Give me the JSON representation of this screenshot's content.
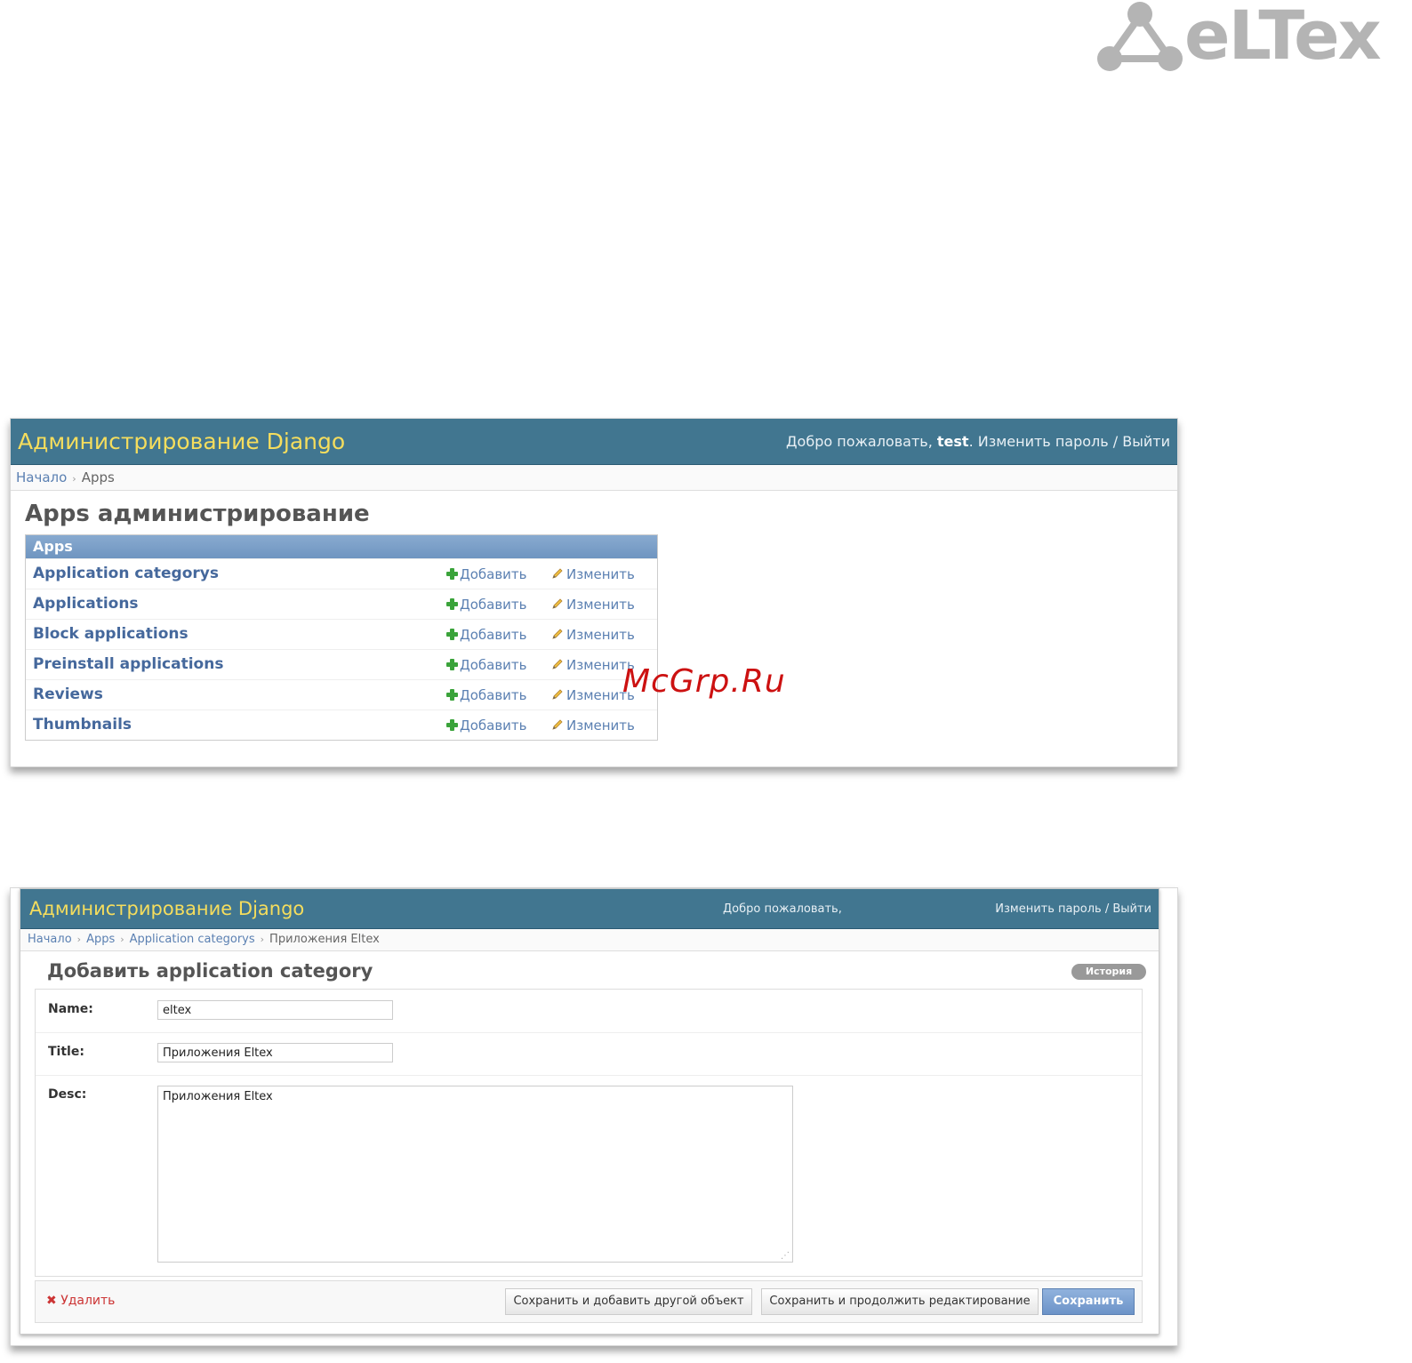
{
  "logo": {
    "text": "eLTex"
  },
  "watermark": "McGrp.Ru",
  "screen1": {
    "header": {
      "title": "Администрирование Django",
      "welcome": "Добро пожаловать,",
      "username": "test",
      "change_password": "Изменить пароль",
      "separator": "/",
      "logout": "Выйти"
    },
    "breadcrumbs": [
      "Начало",
      "Apps"
    ],
    "page_title": "Apps администрирование",
    "module_caption": "Apps",
    "rows": [
      {
        "name": "Application categorys",
        "add": "Добавить",
        "change": "Изменить"
      },
      {
        "name": "Applications",
        "add": "Добавить",
        "change": "Изменить"
      },
      {
        "name": "Block applications",
        "add": "Добавить",
        "change": "Изменить"
      },
      {
        "name": "Preinstall applications",
        "add": "Добавить",
        "change": "Изменить"
      },
      {
        "name": "Reviews",
        "add": "Добавить",
        "change": "Изменить"
      },
      {
        "name": "Thumbnails",
        "add": "Добавить",
        "change": "Изменить"
      }
    ]
  },
  "screen2": {
    "header": {
      "title": "Администрирование Django",
      "welcome": "Добро пожаловать,",
      "change_password": "Изменить пароль",
      "separator": "/",
      "logout": "Выйти"
    },
    "breadcrumbs": [
      "Начало",
      "Apps",
      "Application categorys",
      "Приложения Eltex"
    ],
    "page_title": "Добавить application category",
    "history": "История",
    "fields": {
      "name": {
        "label": "Name:",
        "value": "eltex"
      },
      "title": {
        "label": "Title:",
        "value": "Приложения Eltex"
      },
      "desc": {
        "label": "Desc:",
        "value": "Приложения Eltex"
      }
    },
    "delete": "Удалить",
    "buttons": {
      "save_add_another": "Сохранить и добавить другой объект",
      "save_continue": "Сохранить и продолжить редактирование",
      "save": "Сохранить"
    }
  },
  "colors": {
    "header_bg": "#417690",
    "title_yellow": "#f5dd5d",
    "link_blue": "#5b80b2",
    "module_caption": "#7ca0c7"
  }
}
